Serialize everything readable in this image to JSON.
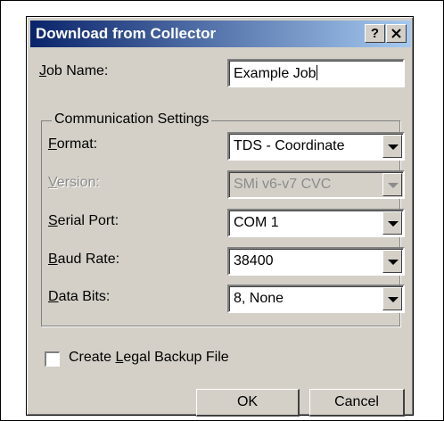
{
  "dialog": {
    "title": "Download from Collector",
    "help_glyph": "?",
    "close_glyph": "✕"
  },
  "job": {
    "label_u": "J",
    "label_rest": "ob Name:",
    "value": "Example Job"
  },
  "comm": {
    "group_title": "Communication Settings",
    "format": {
      "label_u": "F",
      "label_rest": "ormat:",
      "value": "TDS - Coordinate"
    },
    "version": {
      "label_u": "V",
      "label_rest": "ersion:",
      "value": "SMi v6-v7 CVC",
      "disabled": true
    },
    "serial": {
      "label_u": "S",
      "label_rest": "erial Port:",
      "value": "COM 1"
    },
    "baud": {
      "label_u": "B",
      "label_rest": "aud Rate:",
      "value": "38400"
    },
    "databits": {
      "label_u": "D",
      "label_rest": "ata Bits:",
      "value": "8, None"
    }
  },
  "backup": {
    "label_pre": "Create ",
    "label_u": "L",
    "label_rest": "egal Backup File",
    "checked": false
  },
  "buttons": {
    "ok": "OK",
    "cancel": "Cancel"
  }
}
